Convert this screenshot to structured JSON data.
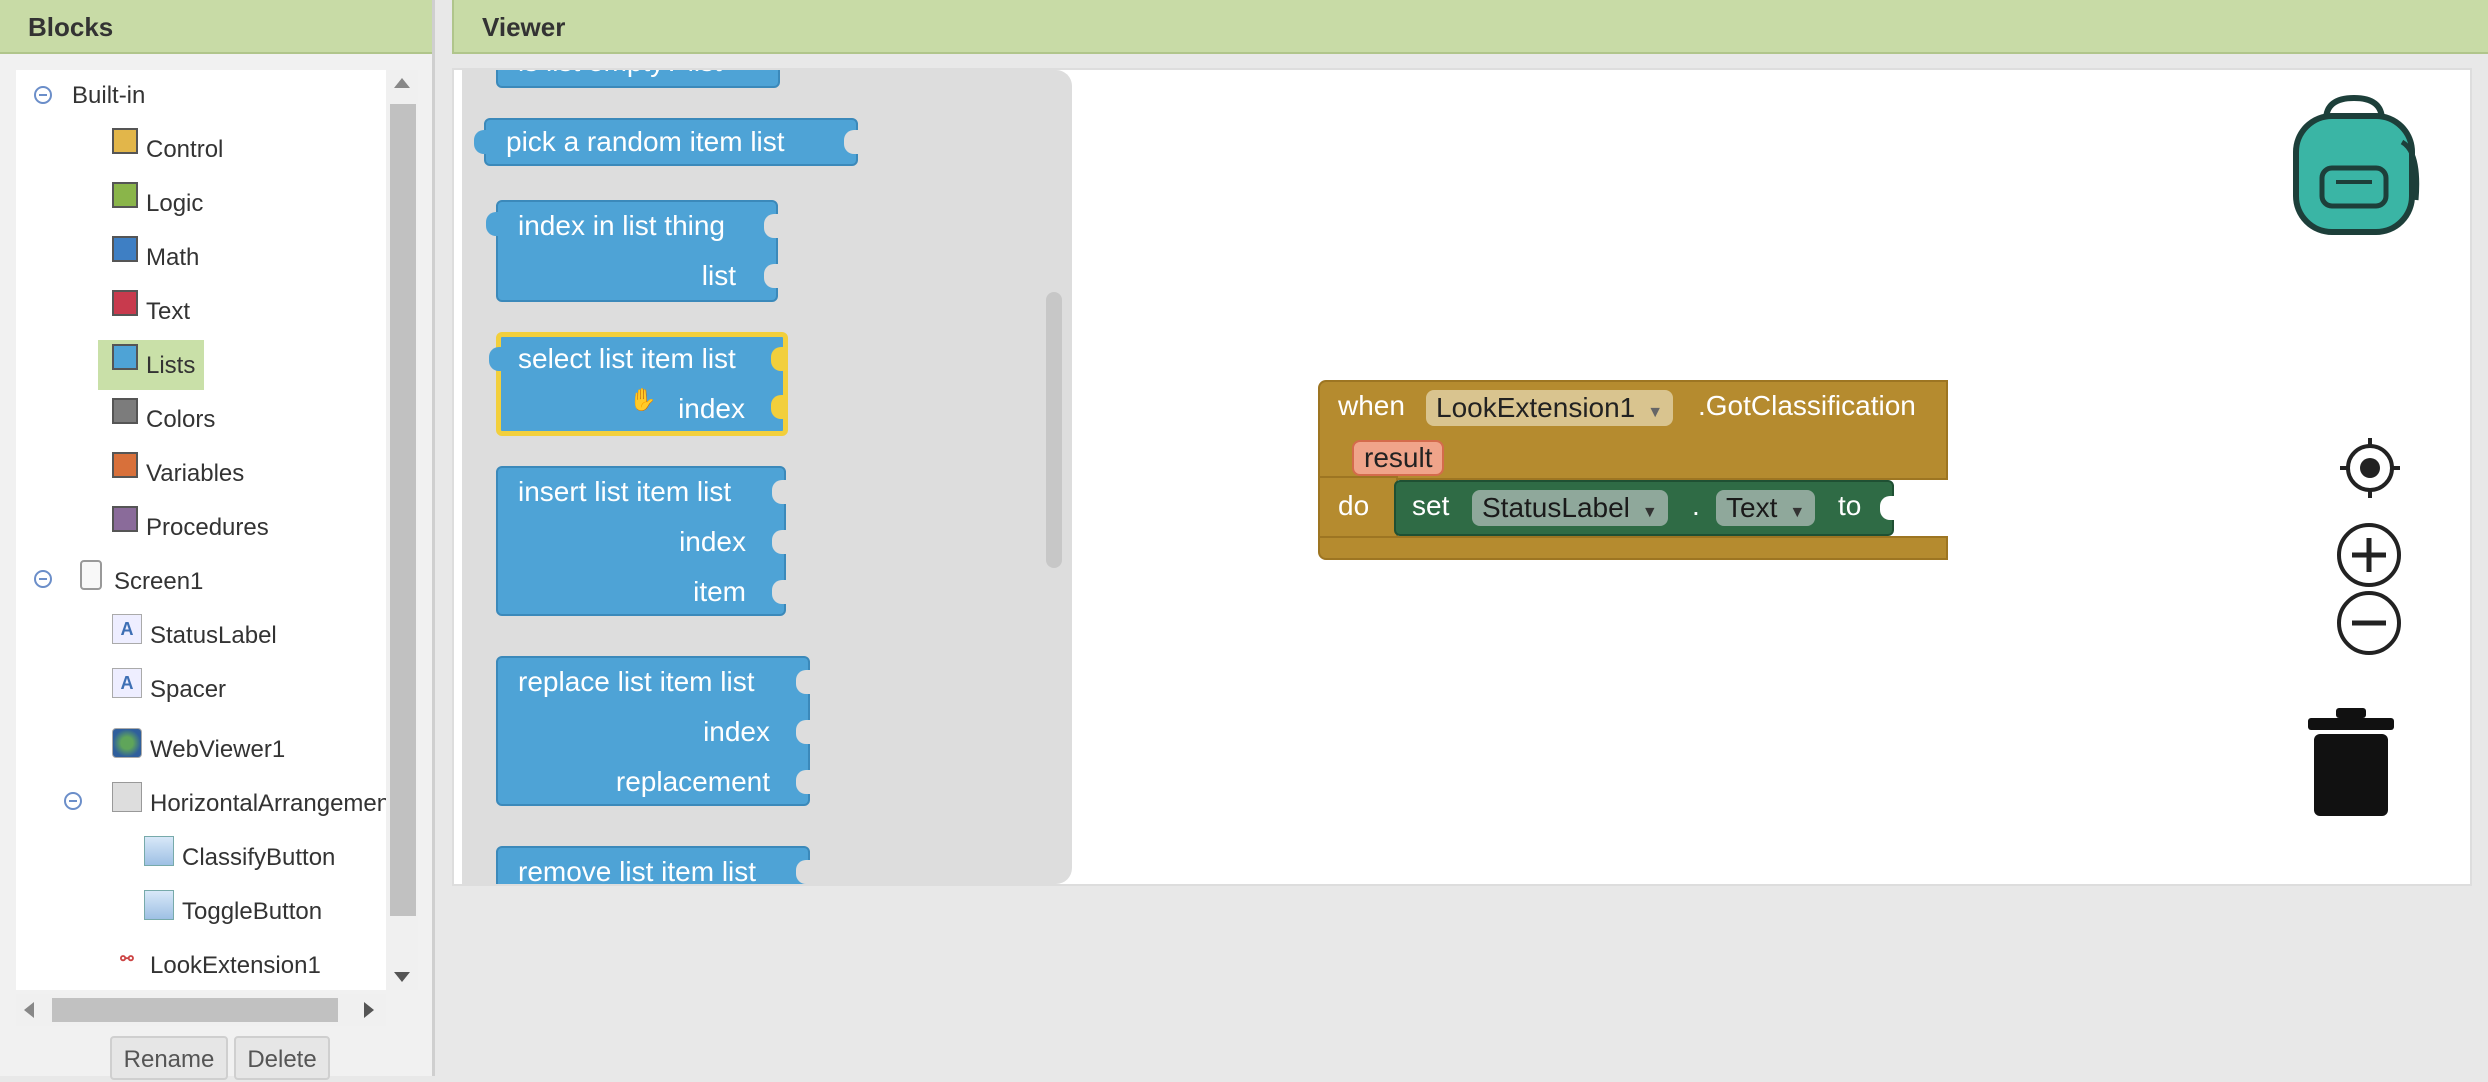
{
  "blocks_panel": {
    "title": "Blocks",
    "builtin_label": "Built-in",
    "categories": [
      {
        "label": "Control",
        "color": "#e2b64a"
      },
      {
        "label": "Logic",
        "color": "#8ab54a"
      },
      {
        "label": "Math",
        "color": "#3e7fc4"
      },
      {
        "label": "Text",
        "color": "#c83a4d"
      },
      {
        "label": "Lists",
        "color": "#4ea3d6",
        "selected": true
      },
      {
        "label": "Colors",
        "color": "#7c7c7c"
      },
      {
        "label": "Variables",
        "color": "#d8703a"
      },
      {
        "label": "Procedures",
        "color": "#8a6b9a"
      }
    ],
    "screen_label": "Screen1",
    "components": [
      {
        "label": "StatusLabel",
        "icon": "label-icon"
      },
      {
        "label": "Spacer",
        "icon": "label-icon"
      },
      {
        "label": "WebViewer1",
        "icon": "globe-icon"
      },
      {
        "label": "HorizontalArrangemen",
        "icon": "arrangement-icon"
      },
      {
        "label": "ClassifyButton",
        "icon": "button-icon"
      },
      {
        "label": "ToggleButton",
        "icon": "button-icon"
      },
      {
        "label": "LookExtension1",
        "icon": "extension-icon"
      }
    ],
    "rename_label": "Rename",
    "delete_label": "Delete"
  },
  "viewer": {
    "title": "Viewer",
    "flyout_blocks": {
      "b0": "is list empty?  list",
      "b1": "pick a random item  list",
      "b2_line1": "index in list  thing",
      "b2_line2": "list",
      "b3_line1": "select list item  list",
      "b3_line2": "index",
      "b4_line1": "insert list item  list",
      "b4_line2": "index",
      "b4_line3": "item",
      "b5_line1": "replace list item  list",
      "b5_line2": "index",
      "b5_line3": "replacement",
      "b6": "remove list item  list"
    },
    "event_block": {
      "when": "when",
      "component": "LookExtension1",
      "event": ".GotClassification",
      "param": "result",
      "do": "do",
      "set": "set",
      "target": "StatusLabel",
      "dot": ".",
      "property": "Text",
      "to": "to"
    }
  }
}
